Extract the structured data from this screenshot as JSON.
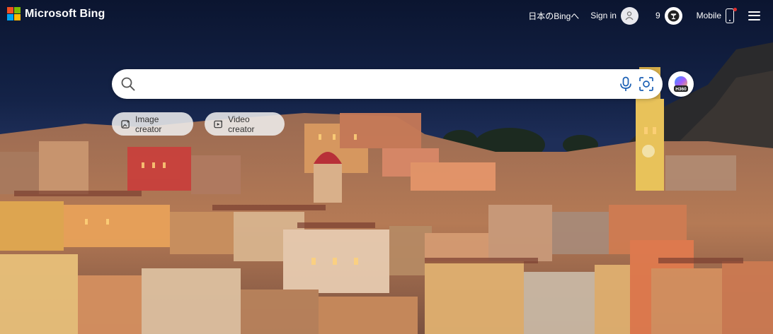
{
  "brand": {
    "name": "Microsoft Bing",
    "colors": [
      "#f25022",
      "#7fba00",
      "#00a4ef",
      "#ffb900"
    ]
  },
  "header": {
    "language_link": "日本のBingへ",
    "sign_in": "Sign in",
    "rewards_points": "9",
    "mobile": "Mobile",
    "icons": [
      "avatar-icon",
      "rewards-icon",
      "phone-icon",
      "menu-icon"
    ]
  },
  "search": {
    "value": "",
    "placeholder": "",
    "icons": [
      "search-icon",
      "microphone-icon",
      "visual-search-icon",
      "copilot-icon"
    ]
  },
  "copilot": {
    "badge": "H360"
  },
  "chips": [
    {
      "label": "Image creator",
      "icon": "image-creator-icon"
    },
    {
      "label": "Video creator",
      "icon": "video-creator-icon"
    }
  ],
  "background": {
    "description_colors": {
      "sky": "#0c1633",
      "buildings": "#c97a4a"
    }
  }
}
